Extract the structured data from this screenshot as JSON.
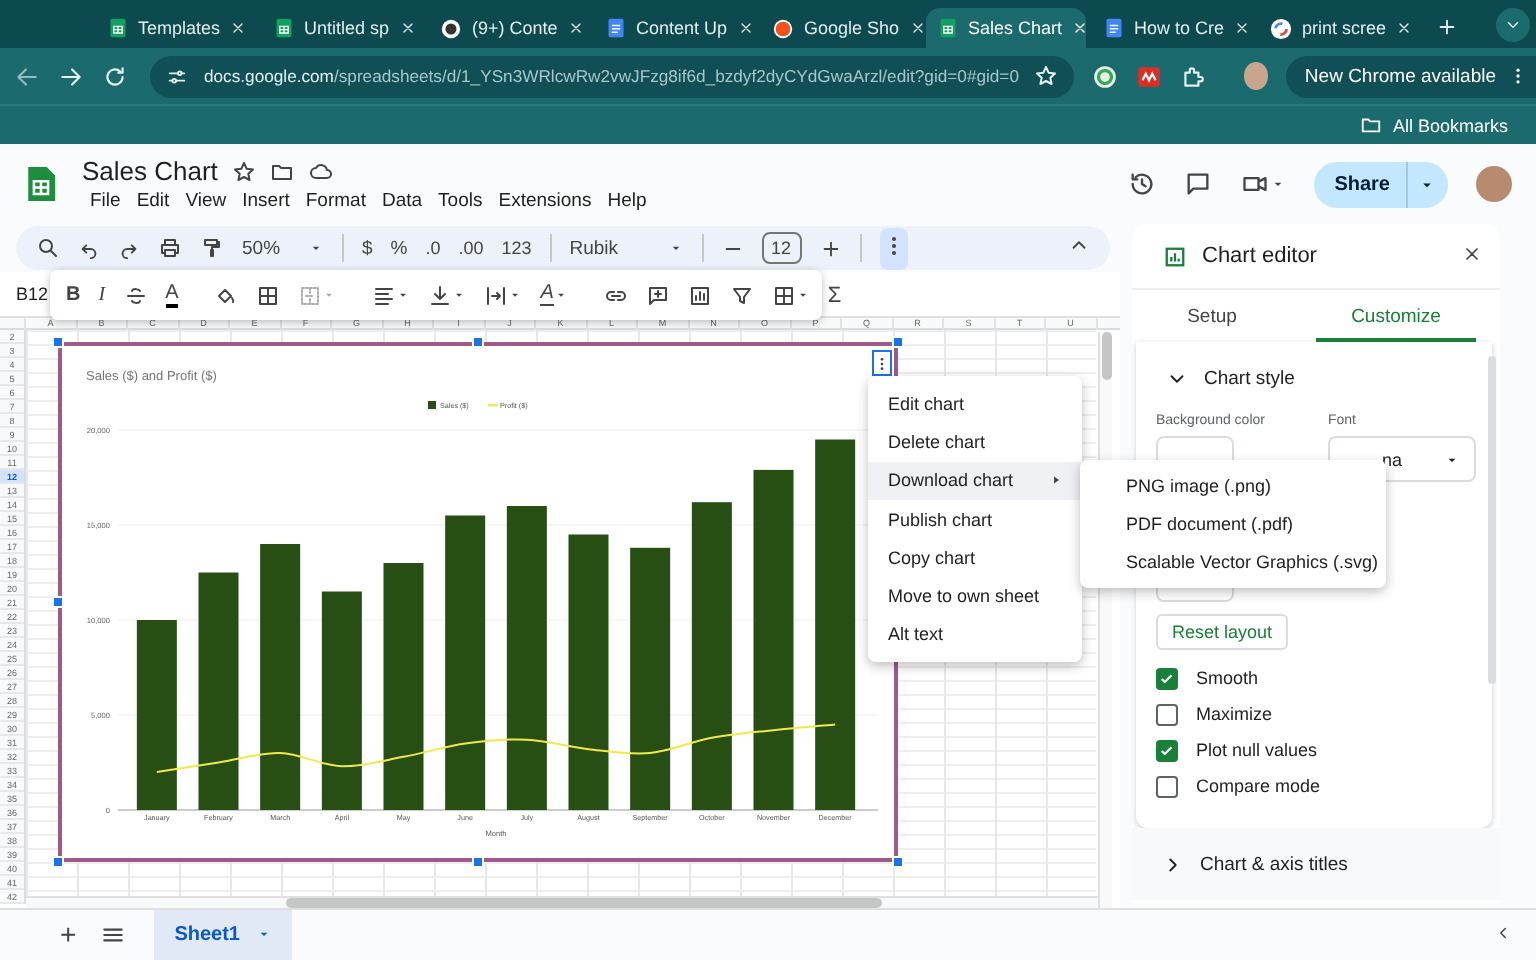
{
  "browser": {
    "tabs": [
      {
        "title": "Templates",
        "kind": "sheets",
        "selected": false
      },
      {
        "title": "Untitled sp",
        "kind": "sheets",
        "selected": false
      },
      {
        "title": "(9+) Conte",
        "kind": "badge",
        "selected": false
      },
      {
        "title": "Content Up",
        "kind": "docs",
        "selected": false
      },
      {
        "title": "Google Sho",
        "kind": "orange",
        "selected": false
      },
      {
        "title": "Sales Chart",
        "kind": "sheets",
        "selected": true
      },
      {
        "title": "How to Cre",
        "kind": "docs",
        "selected": false
      },
      {
        "title": "print scree",
        "kind": "ring",
        "selected": false
      }
    ],
    "url_host": "docs.google.com",
    "url_path": "/spreadsheets/d/1_YSn3WRlcwRw2vwJFzg8if6d_bzdyf2dyCYdGwaArzl/edit?gid=0#gid=0",
    "update_button": "New Chrome available",
    "bookmarks": "All Bookmarks"
  },
  "document": {
    "title": "Sales Chart",
    "menus": [
      "File",
      "Edit",
      "View",
      "Insert",
      "Format",
      "Data",
      "Tools",
      "Extensions",
      "Help"
    ],
    "share_button": "Share"
  },
  "toolbar": {
    "zoom": "50%",
    "currency": "$",
    "percent": "%",
    "decrease_decimal": ".0",
    "increase_decimal": ".00",
    "number_format": "123",
    "font": "Rubik",
    "font_size": "12"
  },
  "format_bar": {
    "cell_ref": "B12",
    "bold": "B",
    "italic": "I",
    "text_color": "A",
    "text_rotation": "A",
    "functions": "Σ"
  },
  "sheet": {
    "columns": [
      "A",
      "B",
      "C",
      "D",
      "E",
      "F",
      "G",
      "H",
      "I",
      "J",
      "K",
      "L",
      "M",
      "N",
      "O",
      "P",
      "Q",
      "R",
      "S",
      "T",
      "U"
    ],
    "rows": [
      {
        "label": "2",
        "selected": false
      },
      {
        "label": "3",
        "selected": false
      },
      {
        "label": "4",
        "selected": false
      },
      {
        "label": "5",
        "selected": false
      },
      {
        "label": "6",
        "selected": false
      },
      {
        "label": "7",
        "selected": false
      },
      {
        "label": "8",
        "selected": false
      },
      {
        "label": "9",
        "selected": false
      },
      {
        "label": "10",
        "selected": false
      },
      {
        "label": "11",
        "selected": false
      },
      {
        "label": "12",
        "selected": true
      },
      {
        "label": "13",
        "selected": false
      },
      {
        "label": "14",
        "selected": false
      },
      {
        "label": "15",
        "selected": false
      },
      {
        "label": "16",
        "selected": false
      },
      {
        "label": "17",
        "selected": false
      },
      {
        "label": "18",
        "selected": false
      },
      {
        "label": "19",
        "selected": false
      },
      {
        "label": "20",
        "selected": false
      },
      {
        "label": "21",
        "selected": false
      },
      {
        "label": "22",
        "selected": false
      },
      {
        "label": "23",
        "selected": false
      },
      {
        "label": "24",
        "selected": false
      },
      {
        "label": "25",
        "selected": false
      },
      {
        "label": "26",
        "selected": false
      },
      {
        "label": "27",
        "selected": false
      },
      {
        "label": "28",
        "selected": false
      },
      {
        "label": "29",
        "selected": false
      },
      {
        "label": "30",
        "selected": false
      },
      {
        "label": "31",
        "selected": false
      },
      {
        "label": "32",
        "selected": false
      },
      {
        "label": "33",
        "selected": false
      },
      {
        "label": "34",
        "selected": false
      },
      {
        "label": "35",
        "selected": false
      },
      {
        "label": "36",
        "selected": false
      },
      {
        "label": "37",
        "selected": false
      },
      {
        "label": "38",
        "selected": false
      },
      {
        "label": "39",
        "selected": false
      },
      {
        "label": "40",
        "selected": false
      },
      {
        "label": "41",
        "selected": false
      },
      {
        "label": "42",
        "selected": false
      }
    ],
    "chart": {
      "chart_data": {
        "type": "bar",
        "title": "Sales ($) and Profit ($)",
        "xlabel": "Month",
        "categories": [
          "January",
          "February",
          "March",
          "April",
          "May",
          "June",
          "July",
          "August",
          "September",
          "October",
          "November",
          "December"
        ],
        "series": [
          {
            "name": "Sales ($)",
            "color": "#274e13",
            "values": [
              10000,
              12500,
              14000,
              11500,
              13000,
              15500,
              16000,
              14500,
              13800,
              16200,
              17900,
              19500
            ]
          },
          {
            "name": "Profit ($)",
            "color": "#f1e94a",
            "type": "line",
            "values": [
              2000,
              2500,
              3000,
              2300,
              2800,
              3500,
              3700,
              3200,
              3000,
              3800,
              4200,
              4500
            ]
          }
        ],
        "stacked": false,
        "grid": true,
        "legend": "top",
        "ylim": [
          0,
          20000
        ],
        "yticks": [
          {
            "value": 0,
            "label": "0"
          },
          {
            "value": 5000,
            "label": "5,000"
          },
          {
            "value": 10000,
            "label": "10,000"
          },
          {
            "value": 15000,
            "label": "15,000"
          },
          {
            "value": 20000,
            "label": "20,000"
          }
        ]
      }
    }
  },
  "chart_menu": {
    "items": [
      {
        "label": "Edit chart",
        "highlighted": false,
        "submenu": false
      },
      {
        "label": "Delete chart",
        "highlighted": false,
        "submenu": false
      },
      {
        "label": "Download chart",
        "highlighted": true,
        "submenu": true
      },
      {
        "label": "Publish chart",
        "highlighted": false,
        "submenu": false
      },
      {
        "label": "Copy chart",
        "highlighted": false,
        "submenu": false
      },
      {
        "label": "Move to own sheet",
        "highlighted": false,
        "submenu": false
      },
      {
        "label": "Alt text",
        "highlighted": false,
        "submenu": false
      }
    ],
    "submenu": [
      "PNG image (.png)",
      "PDF document (.pdf)",
      "Scalable Vector Graphics (.svg)"
    ]
  },
  "chart_editor": {
    "title": "Chart editor",
    "tabs": [
      {
        "label": "Setup",
        "selected": false
      },
      {
        "label": "Customize",
        "selected": true
      }
    ],
    "sections": [
      {
        "title": "Chart style",
        "expanded": true,
        "background_color_label": "Background color",
        "font_label": "Font",
        "font_value": "na",
        "reset_button": "Reset layout",
        "options": [
          {
            "label": "Smooth",
            "checked": true
          },
          {
            "label": "Maximize",
            "checked": false
          },
          {
            "label": "Plot null values",
            "checked": true
          },
          {
            "label": "Compare mode",
            "checked": false
          }
        ]
      },
      {
        "title": "Chart & axis titles",
        "expanded": false
      }
    ]
  },
  "footer": {
    "add_sheet": "+",
    "sheets": [
      {
        "label": "Sheet1",
        "selected": true
      }
    ]
  }
}
